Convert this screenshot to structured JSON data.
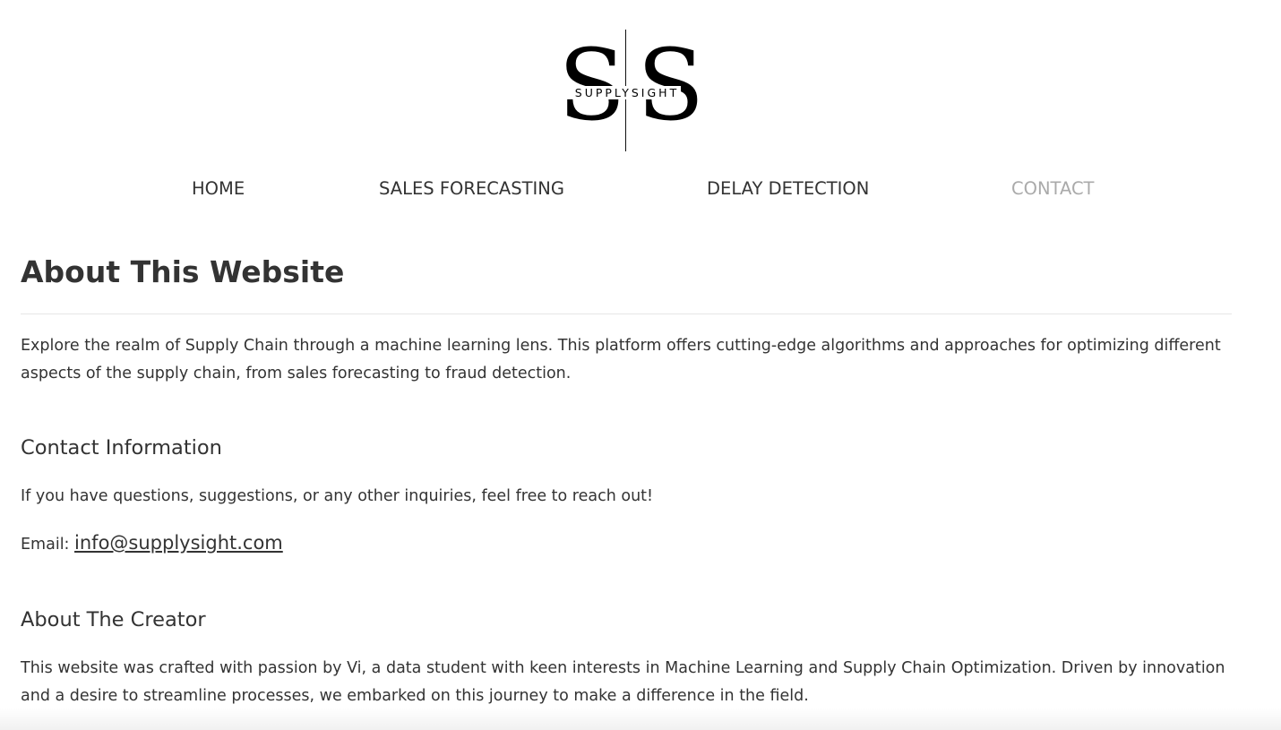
{
  "brand": {
    "logo_letter_left": "S",
    "logo_letter_right": "S",
    "logo_wordmark": "SUPPLYSIGHT"
  },
  "nav": {
    "items": [
      {
        "label": "HOME",
        "active": false
      },
      {
        "label": "SALES FORECASTING",
        "active": false
      },
      {
        "label": "DELAY DETECTION",
        "active": false
      },
      {
        "label": "CONTACT",
        "active": true
      }
    ]
  },
  "main": {
    "title": "About This Website",
    "intro": "Explore the realm of Supply Chain through a machine learning lens. This platform offers cutting-edge algorithms and approaches for optimizing different aspects of the supply chain, from sales forecasting to fraud detection.",
    "contact": {
      "heading": "Contact Information",
      "text": "If you have questions, suggestions, or any other inquiries, feel free to reach out!",
      "email_label": "Email:",
      "email": "info@supplysight.com"
    },
    "creator": {
      "heading": "About The Creator",
      "text": "This website was crafted with passion by Vi, a data student with keen interests in Machine Learning and Supply Chain Optimization. Driven by innovation and a desire to streamline processes, we embarked on this journey to make a difference in the field."
    }
  },
  "colors": {
    "text": "#333333",
    "nav_active": "#aaaaaa",
    "divider": "#e6e6e6",
    "background": "#ffffff"
  }
}
